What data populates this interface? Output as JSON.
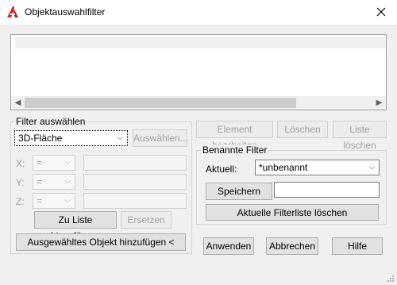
{
  "window": {
    "title": "Objektauswahlfilter",
    "close_glyph": "✕",
    "app_icon": "autocad-logo-icon"
  },
  "filter_group": {
    "label": "Filter auswählen",
    "type_combo_value": "3D-Fläche",
    "select_button": "Auswählen...",
    "x_label": "X:",
    "y_label": "Y:",
    "z_label": "Z:",
    "op_value": "=",
    "add_to_list_button": "Zu Liste hinzufügen:",
    "replace_button": "Ersetzen",
    "add_selected_button": "Ausgewähltes Objekt hinzufügen <"
  },
  "list_actions": {
    "edit_button": "Element bearbeiten",
    "delete_button": "Löschen",
    "clear_list_button": "Liste löschen"
  },
  "named_filters": {
    "label": "Benannte Filter",
    "current_label": "Aktuell:",
    "current_value": "*unbenannt",
    "save_as_button": "Speichern unter:",
    "save_as_value": "",
    "delete_current_button": "Aktuelle Filterliste löschen"
  },
  "footer": {
    "apply": "Anwenden",
    "cancel": "Abbrechen",
    "help": "Hilfe"
  },
  "colors": {
    "accent_red": "#d42b2b",
    "dialog_bg": "#f0f0f0"
  }
}
